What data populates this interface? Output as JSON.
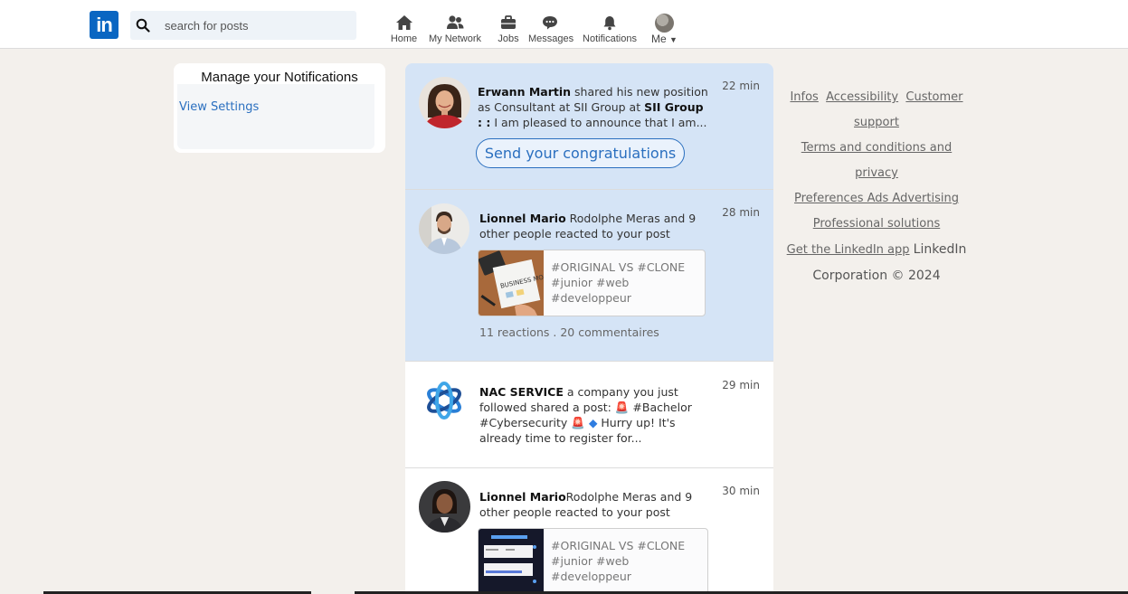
{
  "header": {
    "logo_text": "in",
    "search_placeholder": "search for posts",
    "nav": [
      {
        "label": "Home",
        "icon": "home-icon"
      },
      {
        "label": "My Network",
        "icon": "network-icon"
      },
      {
        "label": "Jobs",
        "icon": "briefcase-icon"
      },
      {
        "label": "Messages",
        "icon": "messages-icon"
      },
      {
        "label": "Notifications",
        "icon": "bell-icon"
      },
      {
        "label": "Me",
        "icon": "avatar"
      }
    ]
  },
  "sidebar": {
    "title": "Manage your Notifications",
    "link": "View Settings"
  },
  "notifications": [
    {
      "time": "22 min",
      "actor": "Erwann Martin",
      "text_a": " shared his new position as Consultant at SII Group at ",
      "org": "SII Group : :",
      "text_b": " I am pleased to announce that I am...",
      "action_label": "Send your congratulations",
      "unread": true
    },
    {
      "time": "28 min",
      "actor": "Lionnel Mario",
      "text_a": " Rodolphe Meras and 9 other people reacted to your post",
      "post_tags": "#ORIGINAL VS #CLONE #junior #web #developpeur",
      "stats": "11 reactions . 20 commentaires",
      "unread": true
    },
    {
      "time": "29 min",
      "actor": "NAC SERVICE",
      "text_a": " a company you just followed shared a post: ",
      "text_b": " #Bachelor #Cybersecurity ",
      "text_c": " Hurry up! It's already time to register for...",
      "unread": false
    },
    {
      "time": "30 min",
      "actor": "Lionnel Mario",
      "text_a": "Rodolphe Meras and 9 other people reacted to your post",
      "post_tags": "#ORIGINAL VS #CLONE #junior #web #developpeur",
      "unread": false
    }
  ],
  "footer_links": {
    "l1": "Infos",
    "l2": "Accessibility",
    "l3": "Customer support",
    "l4": "Terms and conditions and privacy",
    "l5": "Preferences Ads Advertising",
    "l6": "Professional solutions",
    "l7": "Get the LinkedIn app",
    "copyright": "LinkedIn Corporation © 2024"
  },
  "colors": {
    "brand": "#0a66c2",
    "unread_bg": "#d5e4f6",
    "page_bg": "#f3f0ec",
    "link": "#2a6fbf"
  }
}
